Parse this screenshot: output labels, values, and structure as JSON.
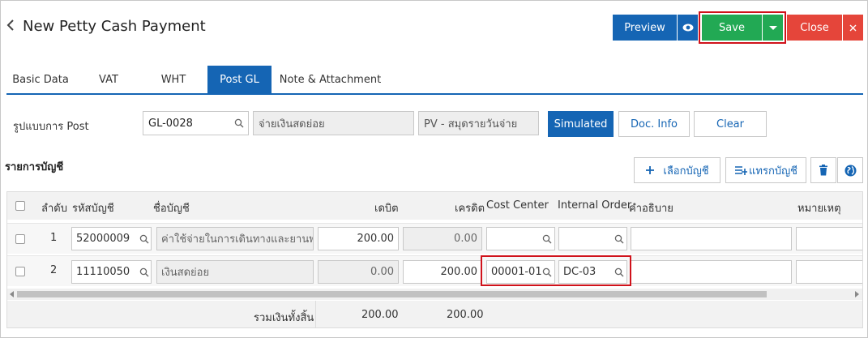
{
  "header": {
    "title": "New Petty Cash Payment",
    "preview_label": "Preview",
    "save_label": "Save",
    "close_label": "Close"
  },
  "tabs": [
    {
      "label": "Basic Data"
    },
    {
      "label": "VAT"
    },
    {
      "label": "WHT"
    },
    {
      "label": "Post GL",
      "active": true
    },
    {
      "label": "Note & Attachment"
    }
  ],
  "post": {
    "label": "รูปแบบการ Post",
    "code": "GL-0028",
    "name": "จ่ายเงินสดย่อย",
    "journal": "PV - สมุดรายวันจ่าย",
    "simulated_label": "Simulated",
    "docinfo_label": "Doc. Info",
    "clear_label": "Clear"
  },
  "accounts": {
    "section_title": "รายการบัญชี",
    "select_label": "เลือกบัญชี",
    "insert_label": "แทรกบัญชี"
  },
  "table": {
    "columns": {
      "no": "ลำดับ",
      "code": "รหัสบัญชี",
      "name": "ชื่อบัญชี",
      "debit": "เดบิต",
      "credit": "เครดิต",
      "cost_center": "Cost Center",
      "internal_order": "Internal Order",
      "description": "คำอธิบาย",
      "remark": "หมายเหตุ"
    },
    "rows": [
      {
        "no": "1",
        "code": "52000009",
        "name": "ค่าใช้จ่ายในการเดินทางและยานพาหนะ",
        "debit": "200.00",
        "credit": "0.00",
        "cost_center": "",
        "internal_order": "",
        "description": "",
        "remark": ""
      },
      {
        "no": "2",
        "code": "11110050",
        "name": "เงินสดย่อย",
        "debit": "0.00",
        "credit": "200.00",
        "cost_center": "00001-01",
        "internal_order": "DC-03",
        "description": "",
        "remark": ""
      }
    ],
    "total_label": "รวมเงินทั้งสิ้น",
    "total_debit": "200.00",
    "total_credit": "200.00"
  },
  "colors": {
    "primary": "#1565b4",
    "save": "#22a954",
    "close": "#e5453a",
    "highlight": "#d0121b"
  },
  "icons": [
    "back-icon",
    "eye-icon",
    "caret-down-icon",
    "close-icon",
    "search-icon",
    "plus-icon",
    "insert-icon",
    "trash-icon",
    "globe-icon"
  ]
}
